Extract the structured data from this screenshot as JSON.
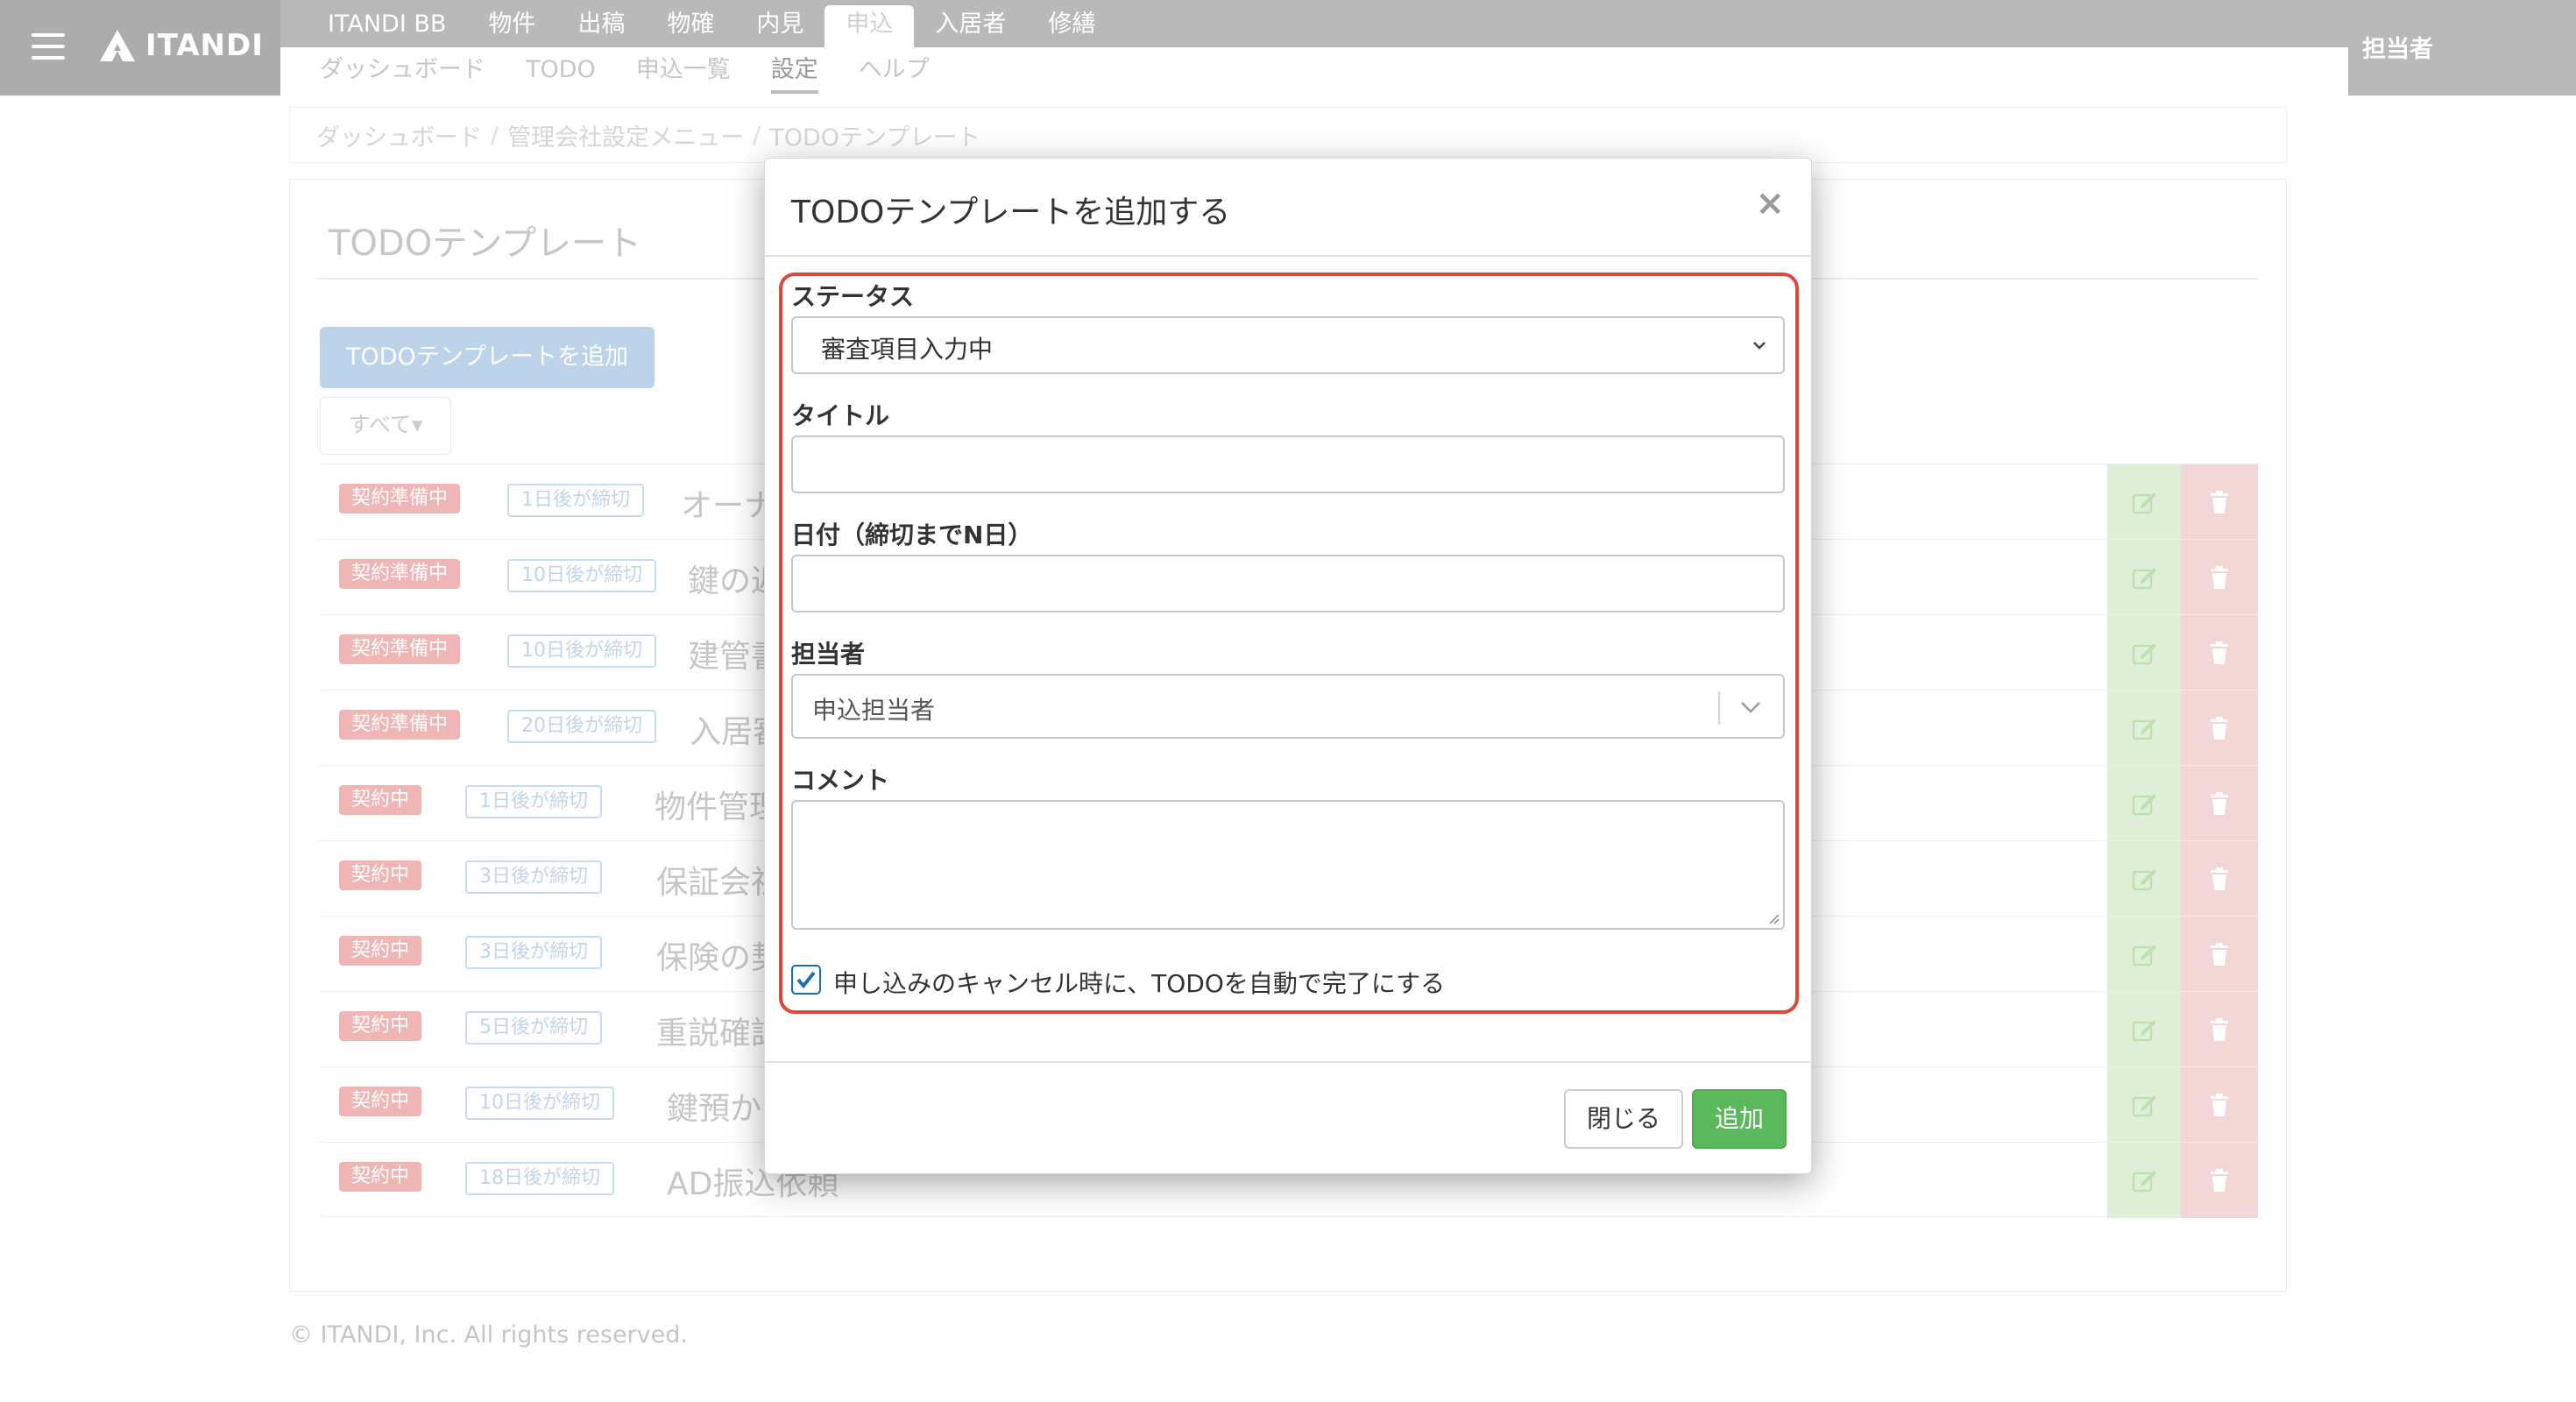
{
  "header": {
    "logo_text": "ITANDI",
    "primary_tabs": [
      "ITANDI BB",
      "物件",
      "出稿",
      "物確",
      "内見",
      "申込",
      "入居者",
      "修繕"
    ],
    "secondary_tabs": [
      "ダッシュボード",
      "TODO",
      "申込一覧",
      "設定",
      "ヘルプ"
    ],
    "user_label": "担当者"
  },
  "breadcrumb": [
    "ダッシュボード",
    "管理会社設定メニュー",
    "TODOテンプレート"
  ],
  "page": {
    "title": "TODOテンプレート",
    "add_button": "TODOテンプレートを追加",
    "filter_button": "すべて"
  },
  "rows": [
    {
      "status": "契約準備中",
      "deadline": "1日後が締切",
      "title": "オーナ"
    },
    {
      "status": "契約準備中",
      "deadline": "10日後が締切",
      "title": "鍵の返"
    },
    {
      "status": "契約準備中",
      "deadline": "10日後が締切",
      "title": "建管書"
    },
    {
      "status": "契約準備中",
      "deadline": "20日後が締切",
      "title": "入居審"
    },
    {
      "status": "契約中",
      "deadline": "1日後が締切",
      "title": "物件管理"
    },
    {
      "status": "契約中",
      "deadline": "3日後が締切",
      "title": "保証会社"
    },
    {
      "status": "契約中",
      "deadline": "3日後が締切",
      "title": "保険の契"
    },
    {
      "status": "契約中",
      "deadline": "5日後が締切",
      "title": "重説確認"
    },
    {
      "status": "契約中",
      "deadline": "10日後が締切",
      "title": "鍵預かり"
    },
    {
      "status": "契約中",
      "deadline": "18日後が締切",
      "title": "AD振込依頼"
    }
  ],
  "footer": "© ITANDI, Inc. All rights reserved.",
  "modal": {
    "title": "TODOテンプレートを追加する",
    "close_icon": "×",
    "status_label": "ステータス",
    "status_value": "審査項目入力中",
    "title_label": "タイトル",
    "title_value": "",
    "date_label": "日付（締切までN日）",
    "date_value": "",
    "assignee_label": "担当者",
    "assignee_value": "申込担当者",
    "comment_label": "コメント",
    "comment_value": "",
    "auto_complete_label": "申し込みのキャンセル時に、TODOを自動で完了にする",
    "auto_complete_checked": true,
    "close_button": "閉じる",
    "add_button": "追加"
  },
  "colors": {
    "highlight": "#e0463a",
    "primary_green": "#5cb85c",
    "checkbox_blue": "#1e6fb0"
  }
}
